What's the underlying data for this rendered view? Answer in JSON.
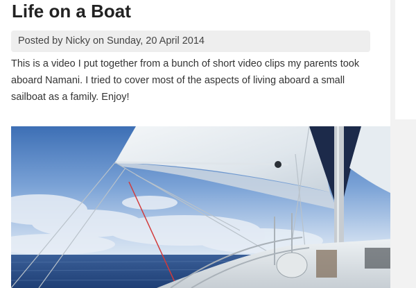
{
  "post": {
    "title": "Life on a Boat",
    "meta": "Posted by Nicky on Sunday, 20 April 2014",
    "body": "This is a video I put together from a bunch of short video clips my parents took aboard Namani. I tried to cover most of the aspects of living aboard a small sailboat as a family. Enjoy!"
  },
  "colors": {
    "sky_top": "#3f73b8",
    "sky_bottom": "#cfdff0",
    "sea": "#2c4f8a",
    "sail": "#e9eef2",
    "sidebar_bg": "#f2f2f2",
    "meta_bg": "#eeeeee"
  }
}
